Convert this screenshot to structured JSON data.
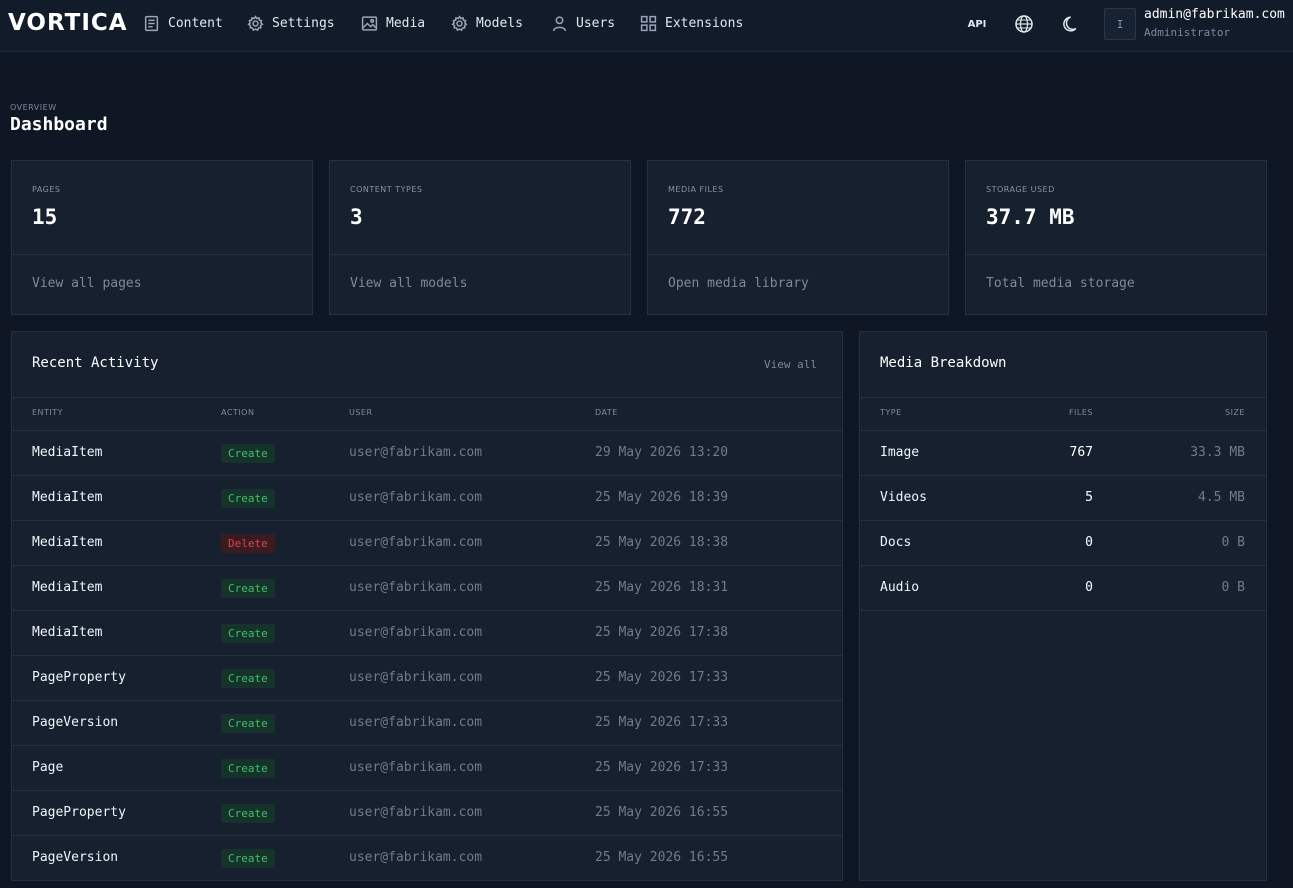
{
  "brand": "VORTICA",
  "nav": [
    {
      "label": "Content",
      "icon": "document-icon"
    },
    {
      "label": "Settings",
      "icon": "gear-icon"
    },
    {
      "label": "Media",
      "icon": "image-icon"
    },
    {
      "label": "Models",
      "icon": "gear-icon"
    },
    {
      "label": "Users",
      "icon": "user-icon"
    },
    {
      "label": "Extensions",
      "icon": "grid-icon"
    }
  ],
  "topbar": {
    "api_label": "API",
    "globe_icon": "globe-icon",
    "theme_icon": "moon-icon",
    "avatar_initial": "I",
    "user_email": "admin@fabrikam.com",
    "user_role": "Administrator"
  },
  "header": {
    "eyebrow": "OVERVIEW",
    "title": "Dashboard"
  },
  "stats": [
    {
      "label": "PAGES",
      "value": "15",
      "link": "View all pages"
    },
    {
      "label": "CONTENT TYPES",
      "value": "3",
      "link": "View all models"
    },
    {
      "label": "MEDIA FILES",
      "value": "772",
      "link": "Open media library"
    },
    {
      "label": "STORAGE USED",
      "value": "37.7 MB",
      "link": "Total media storage"
    }
  ],
  "activity": {
    "title": "Recent Activity",
    "view_all": "View all",
    "columns": [
      "ENTITY",
      "ACTION",
      "USER",
      "DATE"
    ],
    "rows": [
      {
        "entity": "MediaItem",
        "action": "Create",
        "user": "user@fabrikam.com",
        "date": "29 May 2026 13:20"
      },
      {
        "entity": "MediaItem",
        "action": "Create",
        "user": "user@fabrikam.com",
        "date": "25 May 2026 18:39"
      },
      {
        "entity": "MediaItem",
        "action": "Delete",
        "user": "user@fabrikam.com",
        "date": "25 May 2026 18:38"
      },
      {
        "entity": "MediaItem",
        "action": "Create",
        "user": "user@fabrikam.com",
        "date": "25 May 2026 18:31"
      },
      {
        "entity": "MediaItem",
        "action": "Create",
        "user": "user@fabrikam.com",
        "date": "25 May 2026 17:38"
      },
      {
        "entity": "PageProperty",
        "action": "Create",
        "user": "user@fabrikam.com",
        "date": "25 May 2026 17:33"
      },
      {
        "entity": "PageVersion",
        "action": "Create",
        "user": "user@fabrikam.com",
        "date": "25 May 2026 17:33"
      },
      {
        "entity": "Page",
        "action": "Create",
        "user": "user@fabrikam.com",
        "date": "25 May 2026 17:33"
      },
      {
        "entity": "PageProperty",
        "action": "Create",
        "user": "user@fabrikam.com",
        "date": "25 May 2026 16:55"
      },
      {
        "entity": "PageVersion",
        "action": "Create",
        "user": "user@fabrikam.com",
        "date": "25 May 2026 16:55"
      }
    ]
  },
  "breakdown": {
    "title": "Media Breakdown",
    "columns": [
      "TYPE",
      "FILES",
      "SIZE"
    ],
    "rows": [
      {
        "type": "Image",
        "files": "767",
        "size": "33.3 MB"
      },
      {
        "type": "Videos",
        "files": "5",
        "size": "4.5 MB"
      },
      {
        "type": "Docs",
        "files": "0",
        "size": "0 B"
      },
      {
        "type": "Audio",
        "files": "0",
        "size": "0 B"
      }
    ]
  },
  "colors": {
    "background": "#0f1724",
    "panel": "#16202f",
    "border": "#243044",
    "create": "#3fbf6a",
    "delete": "#e0424e"
  }
}
